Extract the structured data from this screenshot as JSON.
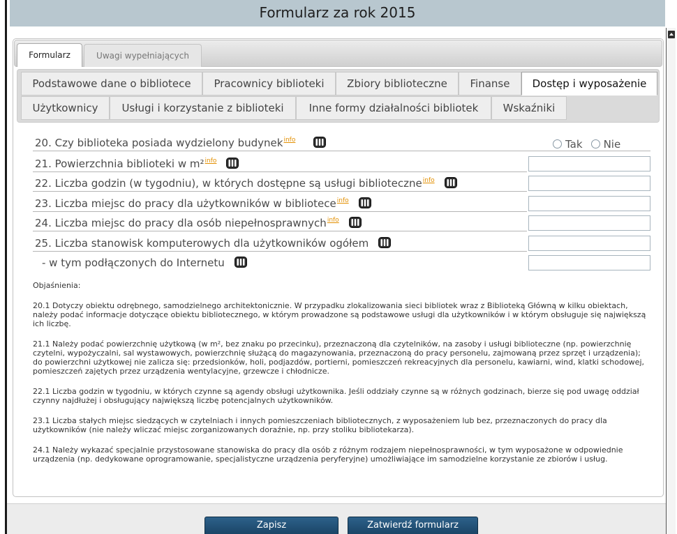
{
  "window": {
    "title": "Formularz za rok 2015"
  },
  "main_tabs": [
    {
      "label": "Formularz",
      "active": true
    },
    {
      "label": "Uwagi wypełniających",
      "active": false
    }
  ],
  "section_tabs": {
    "row1": [
      {
        "label": "Podstawowe dane o bibliotece",
        "active": false
      },
      {
        "label": "Pracownicy biblioteki",
        "active": false
      },
      {
        "label": "Zbiory biblioteczne",
        "active": false
      },
      {
        "label": "Finanse",
        "active": false
      },
      {
        "label": "Dostęp i wyposażenie",
        "active": true
      }
    ],
    "row2": [
      {
        "label": "Użytkownicy",
        "active": false
      },
      {
        "label": "Usługi i korzystanie z biblioteki",
        "active": false
      },
      {
        "label": "Inne formy działalności bibliotek",
        "active": false
      },
      {
        "label": "Wskaźniki",
        "active": false
      }
    ]
  },
  "questions": [
    {
      "label": "20. Czy biblioteka posiada wydzielony budynek",
      "info_link": "info",
      "icon": "gus-definition-icon",
      "options": [
        "Tak",
        "Nie"
      ]
    },
    {
      "label": "21. Powierzchnia biblioteki w m²",
      "info_link": "info",
      "icon": "gus-definition-icon",
      "value": ""
    },
    {
      "label": "22. Liczba godzin (w tygodniu), w których dostępne są usługi biblioteczne",
      "info_link": "info",
      "icon": "gus-definition-icon",
      "value": ""
    },
    {
      "label": "23. Liczba miejsc do pracy dla użytkowników w bibliotece",
      "info_link": "info",
      "icon": "gus-definition-icon",
      "value": ""
    },
    {
      "label": "24. Liczba miejsc do pracy dla osób niepełnosprawnych",
      "info_link": "info",
      "icon": "gus-definition-icon",
      "value": ""
    },
    {
      "label": "25. Liczba stanowisk komputerowych dla użytkowników ogółem",
      "icon": "gus-definition-icon",
      "value": ""
    },
    {
      "label": "- w tym podłączonych do Internetu",
      "icon": "gus-definition-icon",
      "value": ""
    }
  ],
  "explanations": {
    "heading": "Objaśnienia:",
    "items": [
      "20.1 Dotyczy obiektu odrębnego, samodzielnego architektonicznie. W przypadku zlokalizowania sieci bibliotek wraz z Biblioteką Główną w kilku obiektach, należy podać informacje dotyczące obiektu bibliotecznego, w którym prowadzone są podstawowe usługi dla użytkowników i w którym obsługuje się największą ich liczbę.",
      "21.1 Należy podać powierzchnię użytkową (w m², bez znaku po przecinku), przeznaczoną dla czytelników, na zasoby i usługi biblioteczne (np. powierzchnię czytelni, wypożyczalni, sal wystawowych, powierzchnię służącą do magazynowania, przeznaczoną do pracy personelu, zajmowaną przez sprzęt i urządzenia); do powierzchni użytkowej nie zalicza się: przedsionków, holi, podjazdów, portierni, pomieszczeń rekreacyjnych dla personelu, kawiarni, wind, klatki schodowej, pomieszczeń zajętych przez urządzenia wentylacyjne, grzewcze i chłodnicze.",
      "22.1 Liczba godzin w tygodniu, w których czynne są agendy obsługi użytkownika. Jeśli oddziały czynne są w różnych godzinach, bierze się pod uwagę oddział czynny najdłużej i obsługujący największą liczbę potencjalnych użytkowników.",
      "23.1 Liczba stałych miejsc siedzących w czytelniach i innych pomieszczeniach bibliotecznych, z wyposażeniem lub bez, przeznaczonych do pracy dla użytkowników (nie należy wliczać miejsc zorganizowanych doraźnie, np. przy stoliku bibliotekarza).",
      "24.1 Należy wykazać specjalnie przystosowane stanowiska do pracy dla osób z różnym rodzajem niepełnosprawności, w tym wyposażone w odpowiednie urządzenia (np. dedykowane oprogramowanie, specjalistyczne urządzenia peryferyjne) umożliwiające im samodzielne korzystanie ze zbiorów i usług."
    ]
  },
  "actions": {
    "save_label": "Zapisz",
    "approve_label": "Zatwierdź formularz"
  },
  "colors": {
    "title_bar": "#b8c7cf",
    "button": "#1f4b6c",
    "info_link": "#e38f00",
    "tab": "#eeeeee",
    "active_tab": "#ffffff",
    "input_border": "#a7b4bd"
  }
}
